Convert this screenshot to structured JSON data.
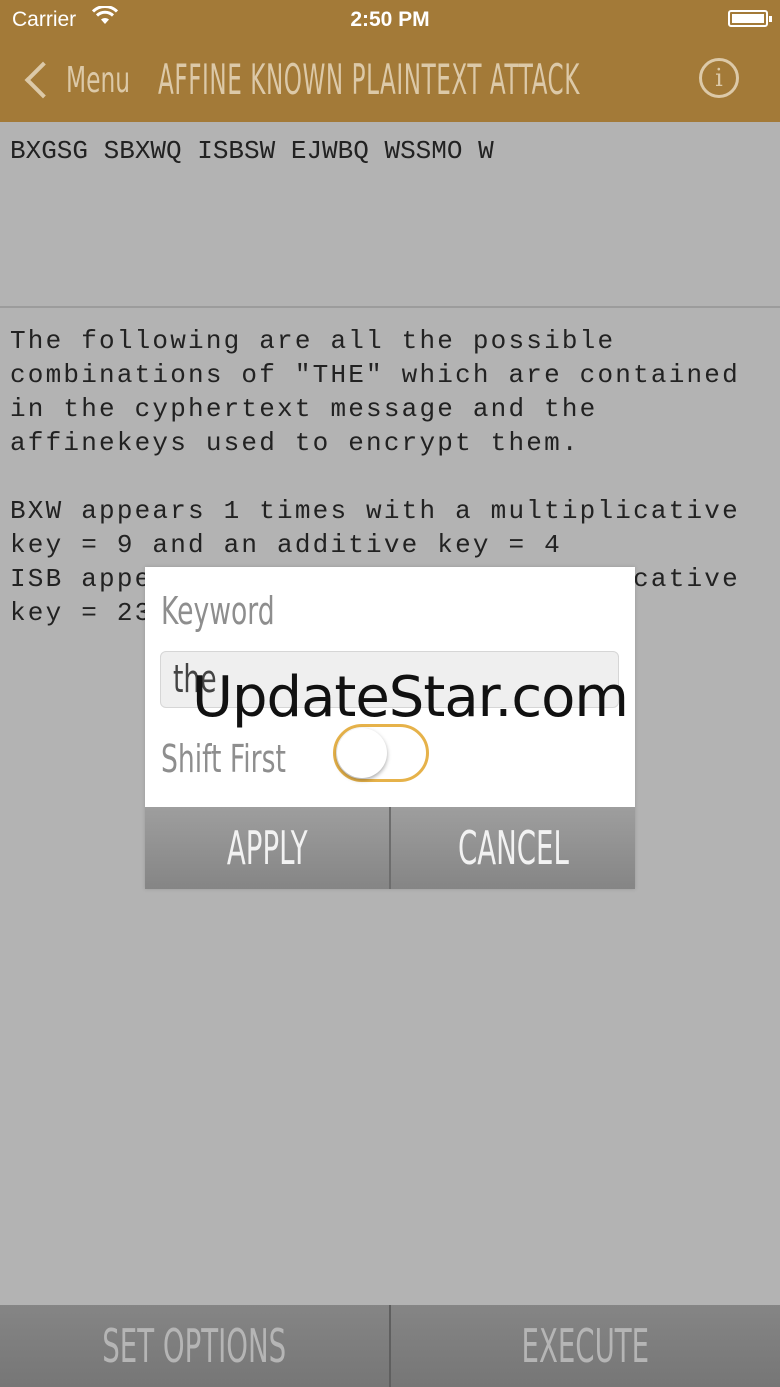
{
  "status_bar": {
    "carrier": "Carrier",
    "time": "2:50 PM"
  },
  "nav": {
    "back_label": "Menu",
    "title": "AFFINE KNOWN PLAINTEXT ATTACK",
    "info_icon": "info-icon",
    "info_glyph": "i"
  },
  "cipher_text": "BXGSG SBXWQ ISBSW EJWBQ WSSMO W",
  "result_text": "The following are all the possible\ncombinations of \"THE\" which are contained\nin the cyphertext message and the\naffinekeys used to encrypt them.\n\nBXW appears 1 times with a multiplicative\nkey = 9 and an additive key = 4\nISB appe                         licative\nkey = 23",
  "dialog": {
    "keyword_label": "Keyword",
    "keyword_value": "the",
    "shift_label": "Shift First",
    "shift_on": false,
    "apply_label": "APPLY",
    "cancel_label": "CANCEL"
  },
  "watermark": "UpdateStar.com",
  "toolbar": {
    "set_options_label": "SET OPTIONS",
    "execute_label": "EXECUTE"
  },
  "colors": {
    "nav_bg": "#a37a38",
    "nav_text": "#dcc9a8",
    "toggle_accent": "#e6b24a",
    "background": "#b3b3b3"
  }
}
